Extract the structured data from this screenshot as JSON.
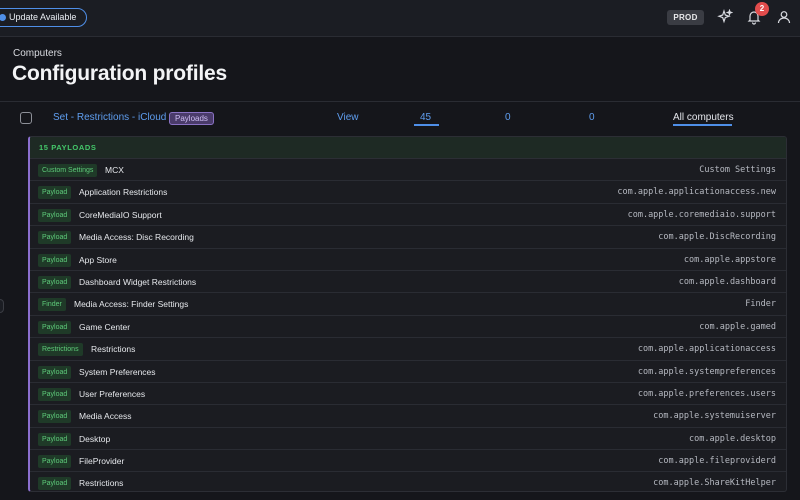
{
  "topbar": {
    "update_label": "Update Available",
    "env_label": "PROD",
    "notification_count": "2",
    "icons": [
      "sparkle-icon",
      "bell-icon",
      "user-icon"
    ]
  },
  "header": {
    "breadcrumb": "Computers",
    "title": "Configuration profiles"
  },
  "profile": {
    "name": "Set - Restrictions - iCloud",
    "badge": "Payloads",
    "view_label": "View",
    "counts": [
      "45",
      "0",
      "0"
    ],
    "scope": "All computers"
  },
  "payloads": {
    "header": "15 PAYLOADS",
    "rows": [
      {
        "tag": "Custom Settings",
        "name": "MCX",
        "id": "Custom Settings"
      },
      {
        "tag": "Payload",
        "name": "Application Restrictions",
        "id": "com.apple.applicationaccess.new"
      },
      {
        "tag": "Payload",
        "name": "CoreMediaIO Support",
        "id": "com.apple.coremediaio.support"
      },
      {
        "tag": "Payload",
        "name": "Media Access: Disc Recording",
        "id": "com.apple.DiscRecording"
      },
      {
        "tag": "Payload",
        "name": "App Store",
        "id": "com.apple.appstore"
      },
      {
        "tag": "Payload",
        "name": "Dashboard Widget Restrictions",
        "id": "com.apple.dashboard"
      },
      {
        "tag": "Finder",
        "name": "Media Access: Finder Settings",
        "id": "Finder"
      },
      {
        "tag": "Payload",
        "name": "Game Center",
        "id": "com.apple.gamed"
      },
      {
        "tag": "Restrictions",
        "name": "Restrictions",
        "id": "com.apple.applicationaccess"
      },
      {
        "tag": "Payload",
        "name": "System Preferences",
        "id": "com.apple.systempreferences"
      },
      {
        "tag": "Payload",
        "name": "User Preferences",
        "id": "com.apple.preferences.users"
      },
      {
        "tag": "Payload",
        "name": "Media Access",
        "id": "com.apple.systemuiserver"
      },
      {
        "tag": "Payload",
        "name": "Desktop",
        "id": "com.apple.desktop"
      },
      {
        "tag": "Payload",
        "name": "FileProvider",
        "id": "com.apple.fileproviderd"
      },
      {
        "tag": "Payload",
        "name": "Restrictions",
        "id": "com.apple.ShareKitHelper"
      }
    ]
  },
  "colors": {
    "accent": "#4f8fe8",
    "link": "#5f9ef0",
    "tag_green": "#5ecb7a",
    "panel_border": "#8b6fcf",
    "badge_red": "#e24c4c"
  }
}
